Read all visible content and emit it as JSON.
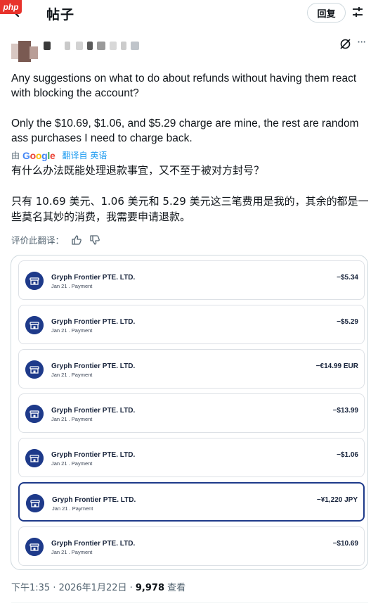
{
  "watermark": {
    "label": "php"
  },
  "header": {
    "title": "帖子",
    "reply_label": "回复"
  },
  "tweet": {
    "paragraph1": "Any suggestions on what to do about refunds without having them react with blocking the account?",
    "paragraph2": "Only the $10.69, $1.06, and $5.29 charge are mine, the rest are random ass purchases I need to charge back.",
    "translated_by_prefix": "由",
    "translated_by_brand": "Google",
    "translated_from_label": "翻译自 英语",
    "zh_paragraph1": "有什么办法既能处理退款事宜，又不至于被对方封号？",
    "zh_paragraph2": "只有 10.69 美元、1.06 美元和 5.29 美元这三笔费用是我的，其余的都是一些莫名其妙的消费，我需要申请退款。",
    "rate_label": "评价此翻译："
  },
  "transactions": [
    {
      "merchant": "Gryph Frontier PTE. LTD.",
      "subtitle": "Jan 21 . Payment",
      "amount": "−$5.34",
      "selected": false
    },
    {
      "merchant": "Gryph Frontier PTE. LTD.",
      "subtitle": "Jan 21 . Payment",
      "amount": "−$5.29",
      "selected": false
    },
    {
      "merchant": "Gryph Frontier PTE. LTD.",
      "subtitle": "Jan 21 . Payment",
      "amount": "−€14.99 EUR",
      "selected": false
    },
    {
      "merchant": "Gryph Frontier PTE. LTD.",
      "subtitle": "Jan 21 . Payment",
      "amount": "−$13.99",
      "selected": false
    },
    {
      "merchant": "Gryph Frontier PTE. LTD.",
      "subtitle": "Jan 21 . Payment",
      "amount": "−$1.06",
      "selected": false
    },
    {
      "merchant": "Gryph Frontier PTE. LTD.",
      "subtitle": "Jan 21 . Payment",
      "amount": "−¥1,220 JPY",
      "selected": true
    },
    {
      "merchant": "Gryph Frontier PTE. LTD.",
      "subtitle": "Jan 21 . Payment",
      "amount": "−$10.69",
      "selected": false
    }
  ],
  "footer": {
    "timestamp": "下午1:35 · 2026年1月22日 · ",
    "views_count": "9,978",
    "views_label": " 查看"
  },
  "colors": {
    "accent": "#1d9bf0",
    "merchant_icon": "#1e3a8a",
    "selected_border": "#1e3a8a"
  },
  "icons": [
    "back-arrow-icon",
    "filter-icon",
    "grok-icon",
    "more-icon",
    "thumbs-up-icon",
    "thumbs-down-icon",
    "store-icon"
  ]
}
